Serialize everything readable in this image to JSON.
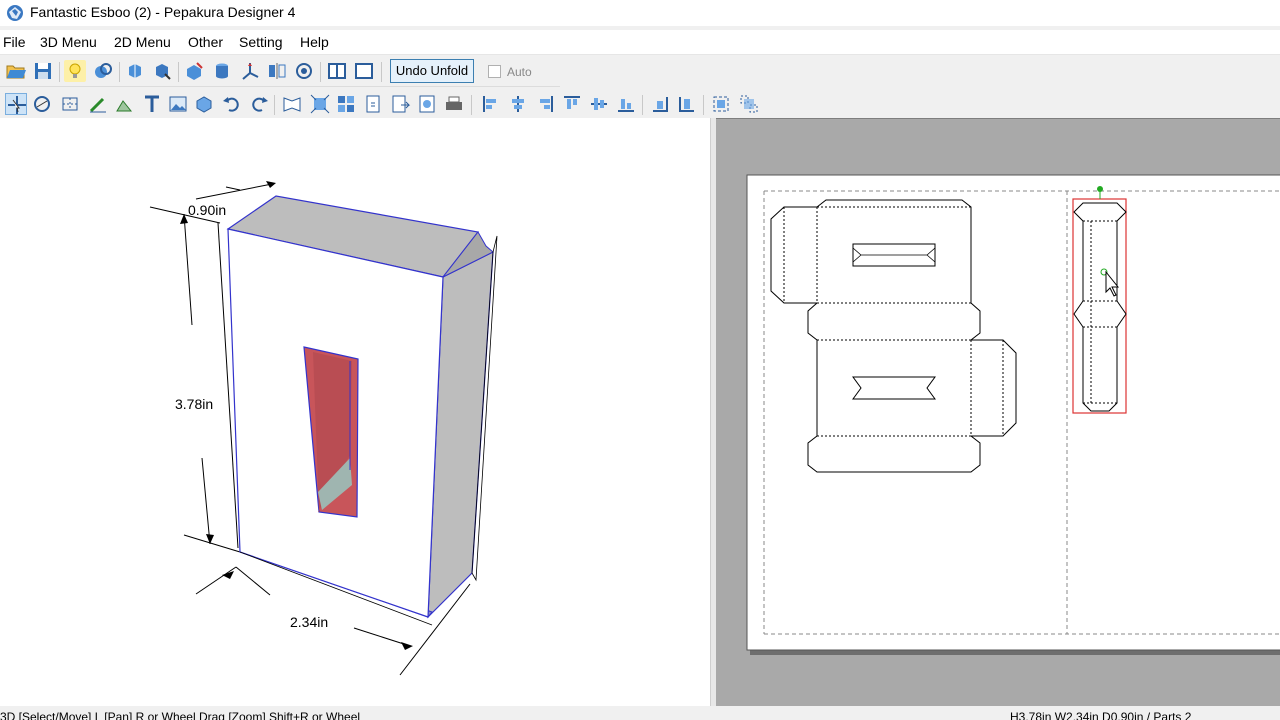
{
  "window": {
    "title": "Fantastic Esboo (2) - Pepakura Designer 4"
  },
  "menu": {
    "items": [
      "File",
      "3D Menu",
      "2D Menu",
      "Other",
      "Setting",
      "Help"
    ]
  },
  "toolbar": {
    "undo_unfold_label": "Undo Unfold",
    "auto_label": "Auto",
    "auto_checked": false
  },
  "view3d": {
    "dim_depth": "0.90in",
    "dim_height": "3.78in",
    "dim_width": "2.34in"
  },
  "status": {
    "left": "3D [Select/Move] L [Pan] R or Wheel Drag [Zoom] Shift+R or Wheel",
    "right": "H3.78in W2.34in D0.90in / Parts 2"
  },
  "colors": {
    "model_edge": "#3333cc",
    "selection": "#d33",
    "window_face": "#c8555a",
    "accent": "#3c7fb1"
  }
}
